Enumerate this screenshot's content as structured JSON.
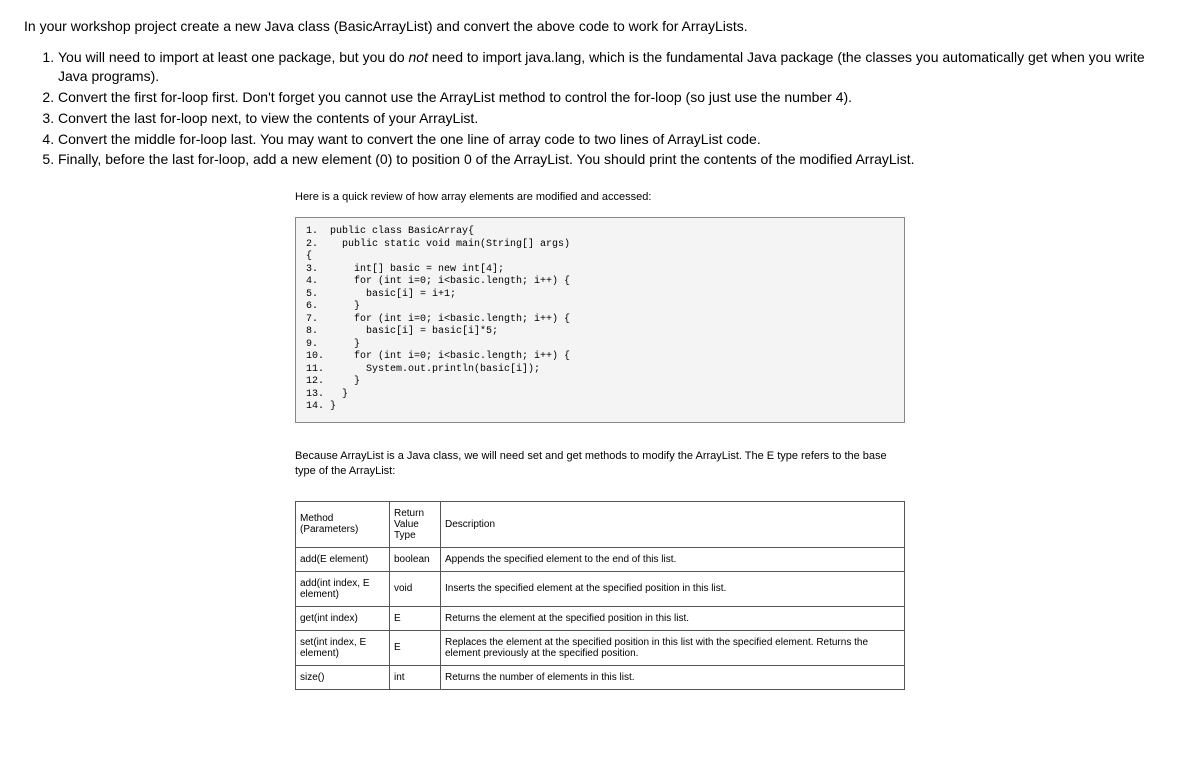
{
  "intro": "In your workshop project create a new Java class (BasicArrayList) and convert the above code to work for ArrayLists.",
  "list": {
    "item1_a": "You will need to import at least one package, but you do ",
    "item1_not": "not",
    "item1_b": " need to import java.lang, which is the fundamental Java package (the classes you automatically get when you write Java programs).",
    "item2": "Convert the first for-loop first. Don't forget you cannot use the ArrayList method to control the for-loop (so just use the number 4).",
    "item3": "Convert the last for-loop next, to view the contents of your ArrayList.",
    "item4": "Convert the middle for-loop last. You may want to convert the one line of array code to two lines of ArrayList code.",
    "item5": "Finally, before the last for-loop, add a new element (0) to position 0 of the ArrayList. You should print the contents of the modified ArrayList."
  },
  "review_text": "Here is a quick review of how array elements are modified and accessed:",
  "code": "1.  public class BasicArray{\n2.    public static void main(String[] args)\n{\n3.      int[] basic = new int[4];\n4.      for (int i=0; i<basic.length; i++) {\n5.        basic[i] = i+1;\n6.      }\n7.      for (int i=0; i<basic.length; i++) {\n8.        basic[i] = basic[i]*5;\n9.      }\n10.     for (int i=0; i<basic.length; i++) {\n11.       System.out.println(basic[i]);\n12.     }\n13.   }\n14. }",
  "because_text": "Because ArrayList is a Java class, we will need set and get methods to modify the ArrayList. The E type refers to the base type of the ArrayList:",
  "table": {
    "headers": {
      "method": "Method (Parameters)",
      "return": "Return Value Type",
      "desc": "Description"
    },
    "rows": [
      {
        "method": "add(E element)",
        "return": "boolean",
        "desc": "Appends the specified element to the end of this list."
      },
      {
        "method": "add(int index, E element)",
        "return": "void",
        "desc": "Inserts the specified element at the specified position in this list."
      },
      {
        "method": "get(int index)",
        "return": "E",
        "desc": "Returns the element at the specified position in this list."
      },
      {
        "method": "set(int index, E element)",
        "return": "E",
        "desc": "Replaces the element at the specified position in this list with the specified element. Returns the element previously at the specified position."
      },
      {
        "method": "size()",
        "return": "int",
        "desc": "Returns the number of elements in this list."
      }
    ]
  }
}
